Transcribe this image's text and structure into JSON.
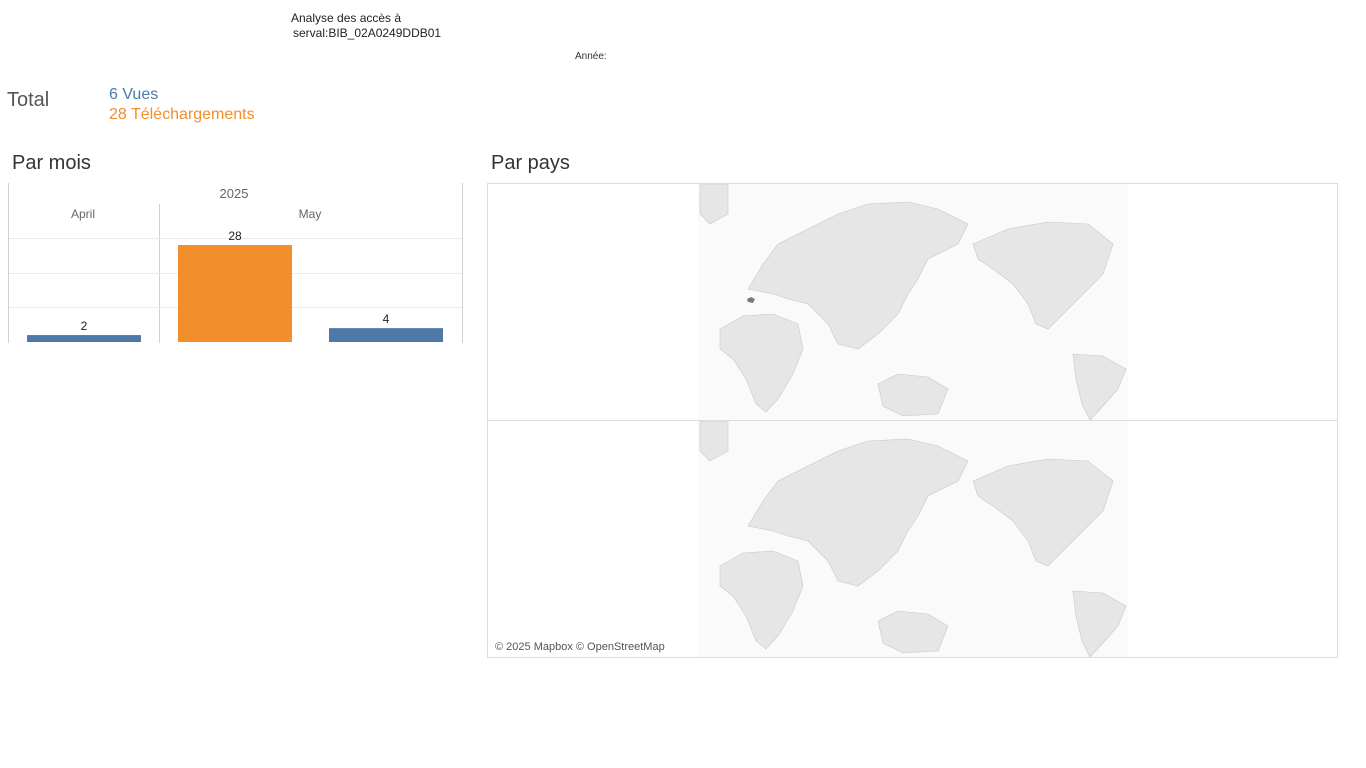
{
  "header": {
    "title_line1": "Analyse des accès à",
    "title_line2": "serval:BIB_02A0249DDB01",
    "year_filter_label": "Année:"
  },
  "totals": {
    "label": "Total",
    "views": "6 Vues",
    "downloads": "28 Téléchargements",
    "views_color": "#4e79a7",
    "downloads_color": "#f28e2b"
  },
  "sections": {
    "monthly_title": "Par mois",
    "country_title": "Par pays"
  },
  "chart_data": {
    "type": "bar",
    "year": "2025",
    "months": [
      "April",
      "May"
    ],
    "bars": [
      {
        "month": "April",
        "series": "Vues",
        "value": 2
      },
      {
        "month": "May",
        "series": "Téléchargements",
        "value": 28
      },
      {
        "month": "May",
        "series": "Vues",
        "value": 4
      }
    ],
    "colors": {
      "Vues": "#4e79a7",
      "Téléchargements": "#f28e2b"
    },
    "ylim": [
      0,
      28
    ]
  },
  "map": {
    "attribution": "© 2025 Mapbox © OpenStreetMap",
    "highlighted_country": "Switzerland"
  }
}
